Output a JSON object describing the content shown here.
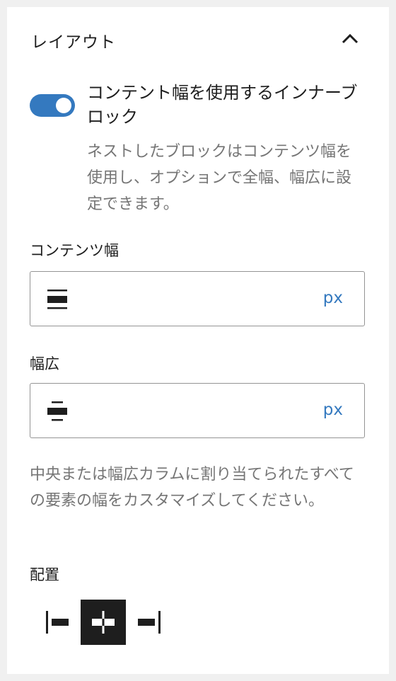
{
  "panel": {
    "title": "レイアウト"
  },
  "toggle": {
    "label": "コンテント幅を使用するインナーブロック",
    "help": "ネストしたブロックはコンテンツ幅を使用し、オプションで全幅、幅広に設定できます。",
    "checked": true,
    "color": "#3479bf"
  },
  "content_width": {
    "label": "コンテンツ幅",
    "value": "",
    "unit": "px",
    "icon": "content-width-icon"
  },
  "wide_width": {
    "label": "幅広",
    "value": "",
    "unit": "px",
    "icon": "wide-width-icon"
  },
  "width_help": "中央または幅広カラムに割り当てられたすべての要素の幅をカスタマイズしてください。",
  "alignment": {
    "label": "配置",
    "options": [
      "justify-left-icon",
      "justify-center-icon",
      "justify-right-icon"
    ],
    "selected": "center"
  },
  "colors": {
    "accent": "#3479bf",
    "text": "#1e1e1e",
    "muted": "#757575"
  }
}
